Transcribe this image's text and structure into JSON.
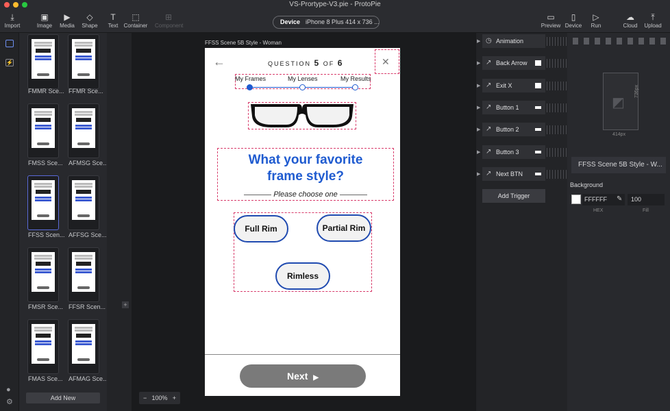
{
  "window": {
    "title": "VS-Prortype-V3.pie - ProtoPie"
  },
  "toolbar": {
    "import": "Import",
    "image": "Image",
    "media": "Media",
    "shape": "Shape",
    "text": "Text",
    "container": "Container",
    "component": "Component",
    "device_label": "Device",
    "device_value": "iPhone 8 Plus  414 x 736  ...",
    "preview": "Preview",
    "device": "Device",
    "run": "Run",
    "cloud": "Cloud",
    "upload": "Upload"
  },
  "scenes": [
    {
      "label": "FMMR Sce..."
    },
    {
      "label": "FFMR Sce..."
    },
    {
      "label": "FMSS Sce..."
    },
    {
      "label": "AFMSG Sce..."
    },
    {
      "label": "FFSS Scen..."
    },
    {
      "label": "AFFSG Sce..."
    },
    {
      "label": "FMSR Sce..."
    },
    {
      "label": "FFSR Scen..."
    },
    {
      "label": "FMAS Sce..."
    },
    {
      "label": "AFMAG Sce..."
    }
  ],
  "scenes_add_new": "Add New",
  "canvas": {
    "scene_title": "FFSS Scene 5B Style - Woman",
    "zoom": "100%",
    "question_prefix": "QUESTION",
    "question_num": "5",
    "question_of": "OF",
    "question_total": "6",
    "steps": [
      "My Frames",
      "My Lenses",
      "My Results"
    ],
    "heading_line1": "What your favorite",
    "heading_line2": "frame style?",
    "subheading": "Please choose one",
    "options": [
      "Full Rim",
      "Partial Rim",
      "Rimless"
    ],
    "next": "Next"
  },
  "triggers": [
    "Animation",
    "Back Arrow",
    "Exit X",
    "Button 1",
    "Button 2",
    "Button 3",
    "Next BTN"
  ],
  "add_trigger": "Add Trigger",
  "props": {
    "width_label": "414px",
    "height_label": "736px",
    "scene_name": "FFSS Scene 5B Style - W...",
    "background_label": "Background",
    "hex": "FFFFFF",
    "hex_label": "HEX",
    "fill": "100",
    "fill_label": "Fill"
  },
  "colors": {
    "accent_blue": "#1f5bd0",
    "bg_dark": "#1e1f22",
    "panel": "#28292d",
    "guide": "#d83a6a"
  }
}
